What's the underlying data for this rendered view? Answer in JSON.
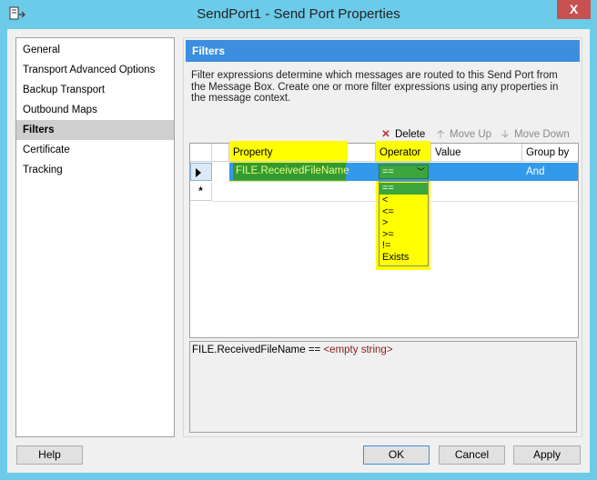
{
  "window": {
    "title": "SendPort1 - Send Port Properties",
    "close_glyph": "X"
  },
  "nav": {
    "items": [
      {
        "label": "General"
      },
      {
        "label": "Transport Advanced Options"
      },
      {
        "label": "Backup Transport"
      },
      {
        "label": "Outbound Maps"
      },
      {
        "label": "Filters"
      },
      {
        "label": "Certificate"
      },
      {
        "label": "Tracking"
      }
    ],
    "selected": "Filters"
  },
  "panel": {
    "title": "Filters",
    "description": "Filter expressions determine which messages are routed to this Send Port from the Message Box. Create one or more filter expressions using any properties in the message context."
  },
  "toolbar": {
    "delete": "Delete",
    "move_up": "Move Up",
    "move_down": "Move Down"
  },
  "grid": {
    "columns": {
      "property": "Property",
      "operator": "Operator",
      "value": "Value",
      "group_by": "Group by"
    },
    "row": {
      "property": "FILE.ReceivedFileName",
      "operator": "==",
      "value": "",
      "group_by": "And"
    },
    "new_row_marker": "*",
    "operator_options": [
      "==",
      "<",
      "<=",
      ">",
      ">=",
      "!=",
      "Exists"
    ]
  },
  "expression": {
    "left": "FILE.ReceivedFileName ==",
    "right": "<empty string>"
  },
  "buttons": {
    "help": "Help",
    "ok": "OK",
    "cancel": "Cancel",
    "apply": "Apply"
  },
  "colors": {
    "header_blue": "#3c8fe0",
    "highlight_yellow": "#ffff00",
    "green": "#339933"
  }
}
